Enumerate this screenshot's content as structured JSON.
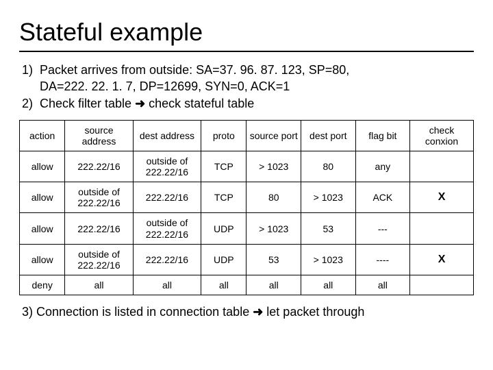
{
  "title": "Stateful example",
  "step1_num": "1)",
  "step1_line1": "Packet arrives from outside: SA=37. 96. 87. 123, SP=80,",
  "step1_line2": "DA=222. 22. 1. 7, DP=12699, SYN=0, ACK=1",
  "step2_num": "2)",
  "step2_text_a": "Check filter table ",
  "step2_arrow": "➜",
  "step2_text_b": " check stateful table",
  "headers": {
    "c0": "action",
    "c1": "source address",
    "c2": "dest address",
    "c3": "proto",
    "c4": "source port",
    "c5": "dest port",
    "c6": "flag bit",
    "c7": "check conxion"
  },
  "rows": [
    {
      "c0": "allow",
      "c1": "222.22/16",
      "c2": "outside of 222.22/16",
      "c3": "TCP",
      "c4": "> 1023",
      "c5": "80",
      "c6": "any",
      "c7": ""
    },
    {
      "c0": "allow",
      "c1": "outside of 222.22/16",
      "c2": "222.22/16",
      "c3": "TCP",
      "c4": "80",
      "c5": "> 1023",
      "c6": "ACK",
      "c7": "X"
    },
    {
      "c0": "allow",
      "c1": "222.22/16",
      "c2": "outside of 222.22/16",
      "c3": "UDP",
      "c4": "> 1023",
      "c5": "53",
      "c6": "---",
      "c7": ""
    },
    {
      "c0": "allow",
      "c1": "outside of 222.22/16",
      "c2": "222.22/16",
      "c3": "UDP",
      "c4": "53",
      "c5": "> 1023",
      "c6": "----",
      "c7": "X"
    },
    {
      "c0": "deny",
      "c1": "all",
      "c2": "all",
      "c3": "all",
      "c4": "all",
      "c5": "all",
      "c6": "all",
      "c7": ""
    }
  ],
  "step3_a": "3) Connection is listed in connection table ",
  "step3_arrow": "➜",
  "step3_b": " let packet through"
}
